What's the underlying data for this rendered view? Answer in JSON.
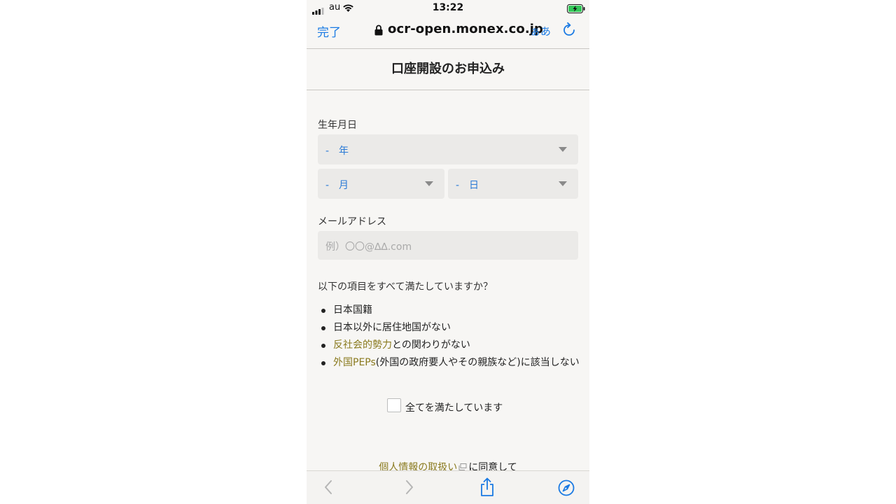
{
  "status_bar": {
    "carrier": "au",
    "time": "13:22",
    "icons": [
      "signal-icon",
      "wifi-icon",
      "battery-charging-icon"
    ]
  },
  "browser": {
    "done_label": "完了",
    "url": "ocr-open.monex.co.jp",
    "text_size_label": "ぁあ",
    "icons": [
      "lock-icon",
      "reload-icon"
    ]
  },
  "page": {
    "title": "口座開設のお申込み",
    "birthdate": {
      "label": "生年月日",
      "year": "-　年",
      "month": "-　月",
      "day": "-　日"
    },
    "email": {
      "label": "メールアドレス",
      "placeholder": "例）〇〇@∆∆.com"
    },
    "requirements": {
      "question": "以下の項目をすべて満たしていますか？",
      "items": [
        {
          "link": "",
          "text": "日本国籍"
        },
        {
          "link": "",
          "text": "日本以外に居住地国がない"
        },
        {
          "link": "反社会的勢力",
          "text": "との関わりがない"
        },
        {
          "link": "外国PEPs",
          "text": "(外国の政府要人やその親族など)に該当しない"
        }
      ],
      "agree_label": "全てを満たしています",
      "agree_checked": false
    },
    "privacy": {
      "link": "個人情報の取扱い",
      "suffix": "に同意して"
    },
    "link_color": "#8a7a1e",
    "accent_color": "#1a7ae3"
  },
  "toolbar": {
    "icons": [
      "back-icon",
      "forward-icon",
      "share-icon",
      "compass-icon"
    ]
  }
}
